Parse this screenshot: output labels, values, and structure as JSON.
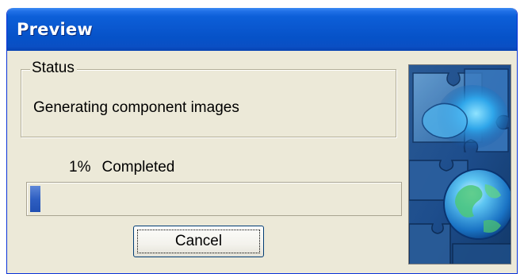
{
  "window": {
    "title": "Preview"
  },
  "status": {
    "legend": "Status",
    "message": "Generating component images"
  },
  "progress": {
    "percent_label": "1%",
    "completed_label": "Completed",
    "value_percent": 1
  },
  "buttons": {
    "cancel_label": "Cancel"
  },
  "colors": {
    "titlebar_blue": "#0a58d0",
    "dialog_background": "#ece9d8",
    "progress_fill": "#2f5fc2"
  },
  "icons": {
    "picture": "puzzle-globe-image"
  }
}
